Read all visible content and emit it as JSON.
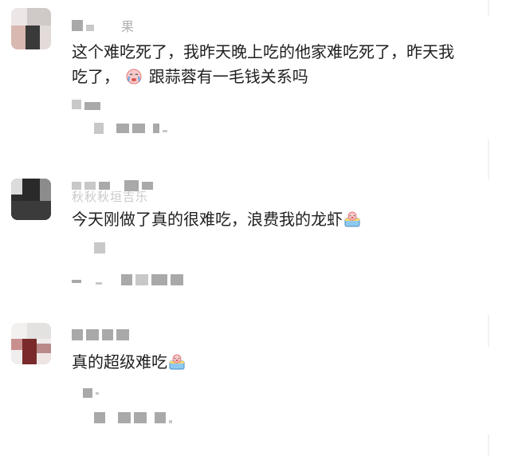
{
  "comments": [
    {
      "name_visible_char": "果",
      "text": "这个难吃死了，我昨天晚上吃的他家难吃死了，昨天我吃了，",
      "text_line1": "这个难吃死了，我昨天晚上吃的他家难吃死了，昨天我",
      "text_line2_pre": "吃了，",
      "text_line2_post": "跟蒜蓉有一毛钱关系吗",
      "emoji": "crying-face-emoji"
    },
    {
      "name_faded": "秋秋秋垣吉乐",
      "text": "今天刚做了真的很难吃，浪费我的龙虾",
      "emoji": "crying-cake-emoji"
    },
    {
      "text": "真的超级难吃",
      "emoji": "crying-cake-emoji"
    }
  ],
  "colors": {
    "text": "#1f1f1f",
    "blur": "#c8c8c8",
    "background": "#ffffff"
  }
}
